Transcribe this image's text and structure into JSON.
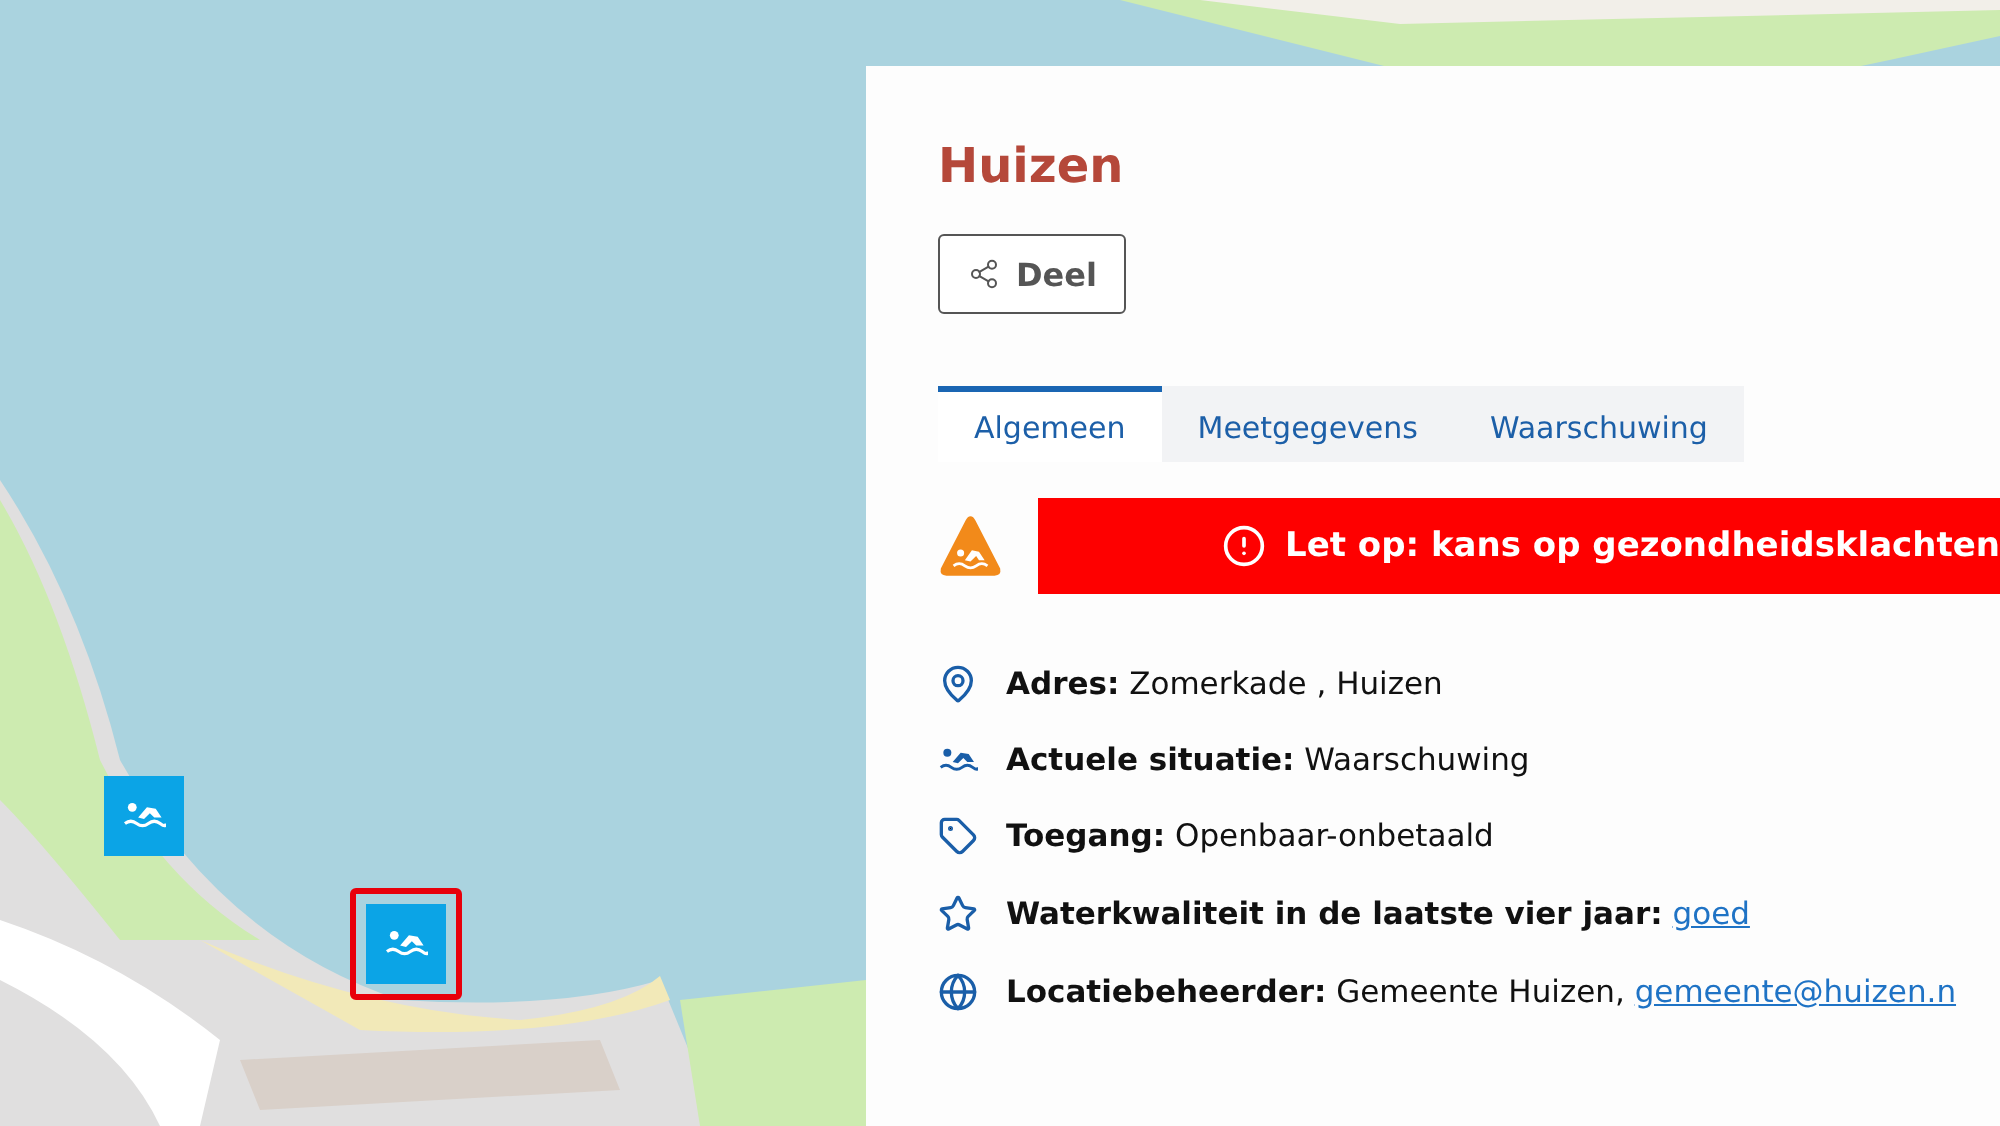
{
  "map": {
    "markers": [
      {
        "selected": false
      },
      {
        "selected": true
      }
    ]
  },
  "panel": {
    "title": "Huizen",
    "share_button": "Deel",
    "tabs": [
      {
        "label": "Algemeen",
        "selected": true
      },
      {
        "label": "Meetgegevens",
        "selected": false
      },
      {
        "label": "Waarschuwing",
        "selected": false
      }
    ],
    "alert": {
      "text": "Let op: kans op gezondheidsklachten"
    },
    "details": [
      {
        "kind": "pin",
        "label": "Adres:",
        "value": "Zomerkade , Huizen"
      },
      {
        "kind": "swim",
        "label": "Actuele situatie:",
        "value": "Waarschuwing"
      },
      {
        "kind": "tag",
        "label": "Toegang:",
        "value": "Openbaar-onbetaald"
      },
      {
        "kind": "star",
        "label": "Waterkwaliteit in de laatste vier jaar:",
        "link": "goed"
      },
      {
        "kind": "globe",
        "label": "Locatiebeheerder:",
        "value": "Gemeente Huizen,",
        "link": "gemeente@huizen.n"
      }
    ]
  }
}
